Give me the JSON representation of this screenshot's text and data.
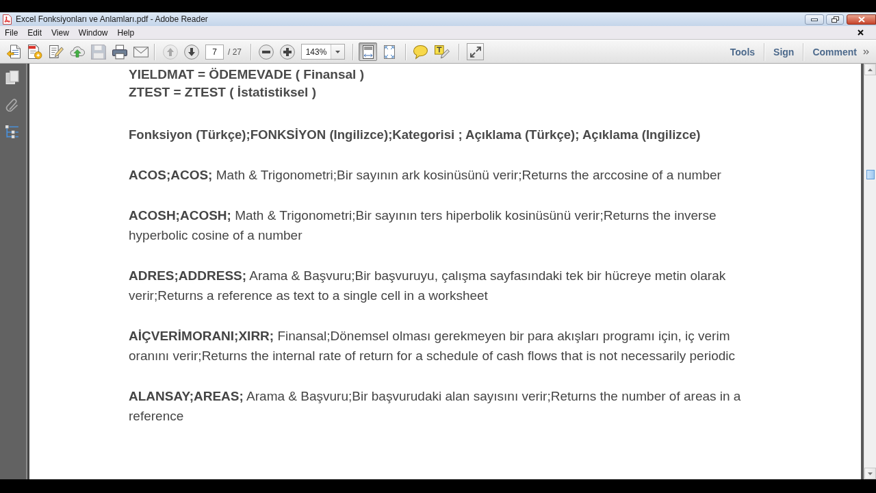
{
  "window": {
    "title": "Excel Fonksiyonları ve Anlamları.pdf - Adobe Reader"
  },
  "menu": [
    "File",
    "Edit",
    "View",
    "Window",
    "Help"
  ],
  "toolbar": {
    "save": {
      "disabled": true
    },
    "previous_page": {
      "disabled": true
    },
    "next_page": {
      "disabled": false
    },
    "page_field": {
      "value": "7"
    },
    "page_count": "/ 27",
    "zoom_field": {
      "value": "143%"
    },
    "view_modes": [
      {
        "selected": true
      },
      {
        "selected": false
      }
    ]
  },
  "panes": [
    "Tools",
    "Sign",
    "Comment"
  ],
  "document": {
    "intro_lines": [
      "YIELDMAT = ÖDEMEVADE ( Finansal )",
      "ZTEST = ZTEST ( İstatistiksel )"
    ],
    "heading": "Fonksiyon (Türkçe);FONKSİYON (Ingilizce);Kategorisi ; Açıklama (Türkçe); Açıklama (Ingilizce)",
    "entries": [
      "**ACOS;ACOS;** Math & Trigonometri;Bir sayının ark kosinüsünü verir;Returns the arccosine of a number",
      "**ACOSH;ACOSH;** Math & Trigonometri;Bir sayının ters hiperbolik kosinüsünü verir;Returns the inverse hyperbolic cosine of a number",
      "**ADRES;ADDRESS;** Arama & Başvuru;Bir başvuruyu, çalışma sayfasındaki tek bir hücreye metin olarak verir;Returns a reference as text to a single cell in a worksheet",
      "**AİÇVERİMORANI;XIRR;** Finansal;Dönemsel olması gerekmeyen bir para akışları programı için, iç verim oranını verir;Returns the internal rate of return for a schedule of cash flows that is not necessarily periodic",
      "**ALANSAY;AREAS;** Arama & Başvuru;Bir başvurudaki alan sayısını verir;Returns the number of areas in a reference"
    ]
  }
}
